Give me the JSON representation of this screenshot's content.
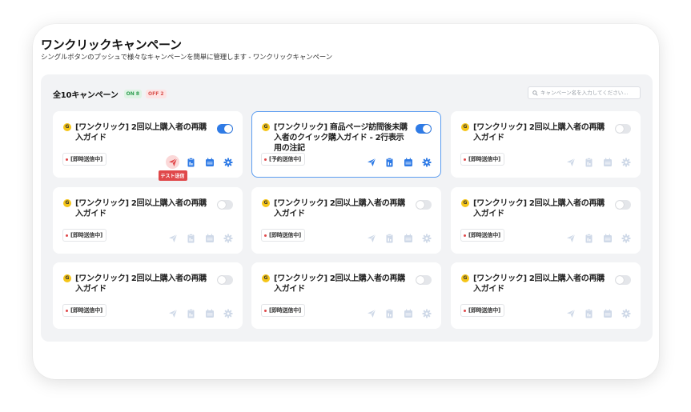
{
  "page": {
    "title": "ワンクリックキャンペーン",
    "subtitle": "シングルボタンのプッシュで様々なキャンペーンを簡単に管理します - ワンクリックキャンペーン"
  },
  "panel": {
    "total_label": "全10キャンペーン",
    "on_badge": "ON 8",
    "off_badge": "OFF 2",
    "search_placeholder": "キャンペーン名を入力してください..."
  },
  "tooltip": {
    "send_test": "テスト送信"
  },
  "colors": {
    "accent_blue": "#2f7be6",
    "accent_red": "#e0484a",
    "icon_gray": "#cfd9e8",
    "coin_yellow": "#f5c518"
  },
  "campaigns": [
    {
      "icon": "coin-icon",
      "icon_glyph": "G",
      "title": "[ワンクリック] 2回以上購入者の再購入ガイド",
      "status": "[即時送信中]",
      "enabled": true,
      "selected": false
    },
    {
      "icon": "coin-icon",
      "icon_glyph": "G",
      "title": "[ワンクリック] 商品ページ訪問後未購入者のクイック購入ガイド - 2行表示用の注記",
      "status": "[予約送信中]",
      "enabled": true,
      "selected": true
    },
    {
      "icon": "coin-icon",
      "icon_glyph": "G",
      "title": "[ワンクリック] 2回以上購入者の再購入ガイド",
      "status": "[即時送信中]",
      "enabled": false,
      "selected": false
    },
    {
      "icon": "coin-icon",
      "icon_glyph": "G",
      "title": "[ワンクリック] 2回以上購入者の再購入ガイド",
      "status": "[即時送信中]",
      "enabled": false,
      "selected": false
    },
    {
      "icon": "coin-icon",
      "icon_glyph": "G",
      "title": "[ワンクリック] 2回以上購入者の再購入ガイド",
      "status": "[即時送信中]",
      "enabled": false,
      "selected": false
    },
    {
      "icon": "coin-icon",
      "icon_glyph": "G",
      "title": "[ワンクリック] 2回以上購入者の再購入ガイド",
      "status": "[即時送信中]",
      "enabled": false,
      "selected": false
    },
    {
      "icon": "coin-icon",
      "icon_glyph": "G",
      "title": "[ワンクリック] 2回以上購入者の再購入ガイド",
      "status": "[即時送信中]",
      "enabled": false,
      "selected": false
    },
    {
      "icon": "coin-icon",
      "icon_glyph": "G",
      "title": "[ワンクリック] 2回以上購入者の再購入ガイド",
      "status": "[即時送信中]",
      "enabled": false,
      "selected": false
    },
    {
      "icon": "coin-icon",
      "icon_glyph": "G",
      "title": "[ワンクリック] 2回以上購入者の再購入ガイド",
      "status": "[即時送信中]",
      "enabled": false,
      "selected": false
    }
  ]
}
